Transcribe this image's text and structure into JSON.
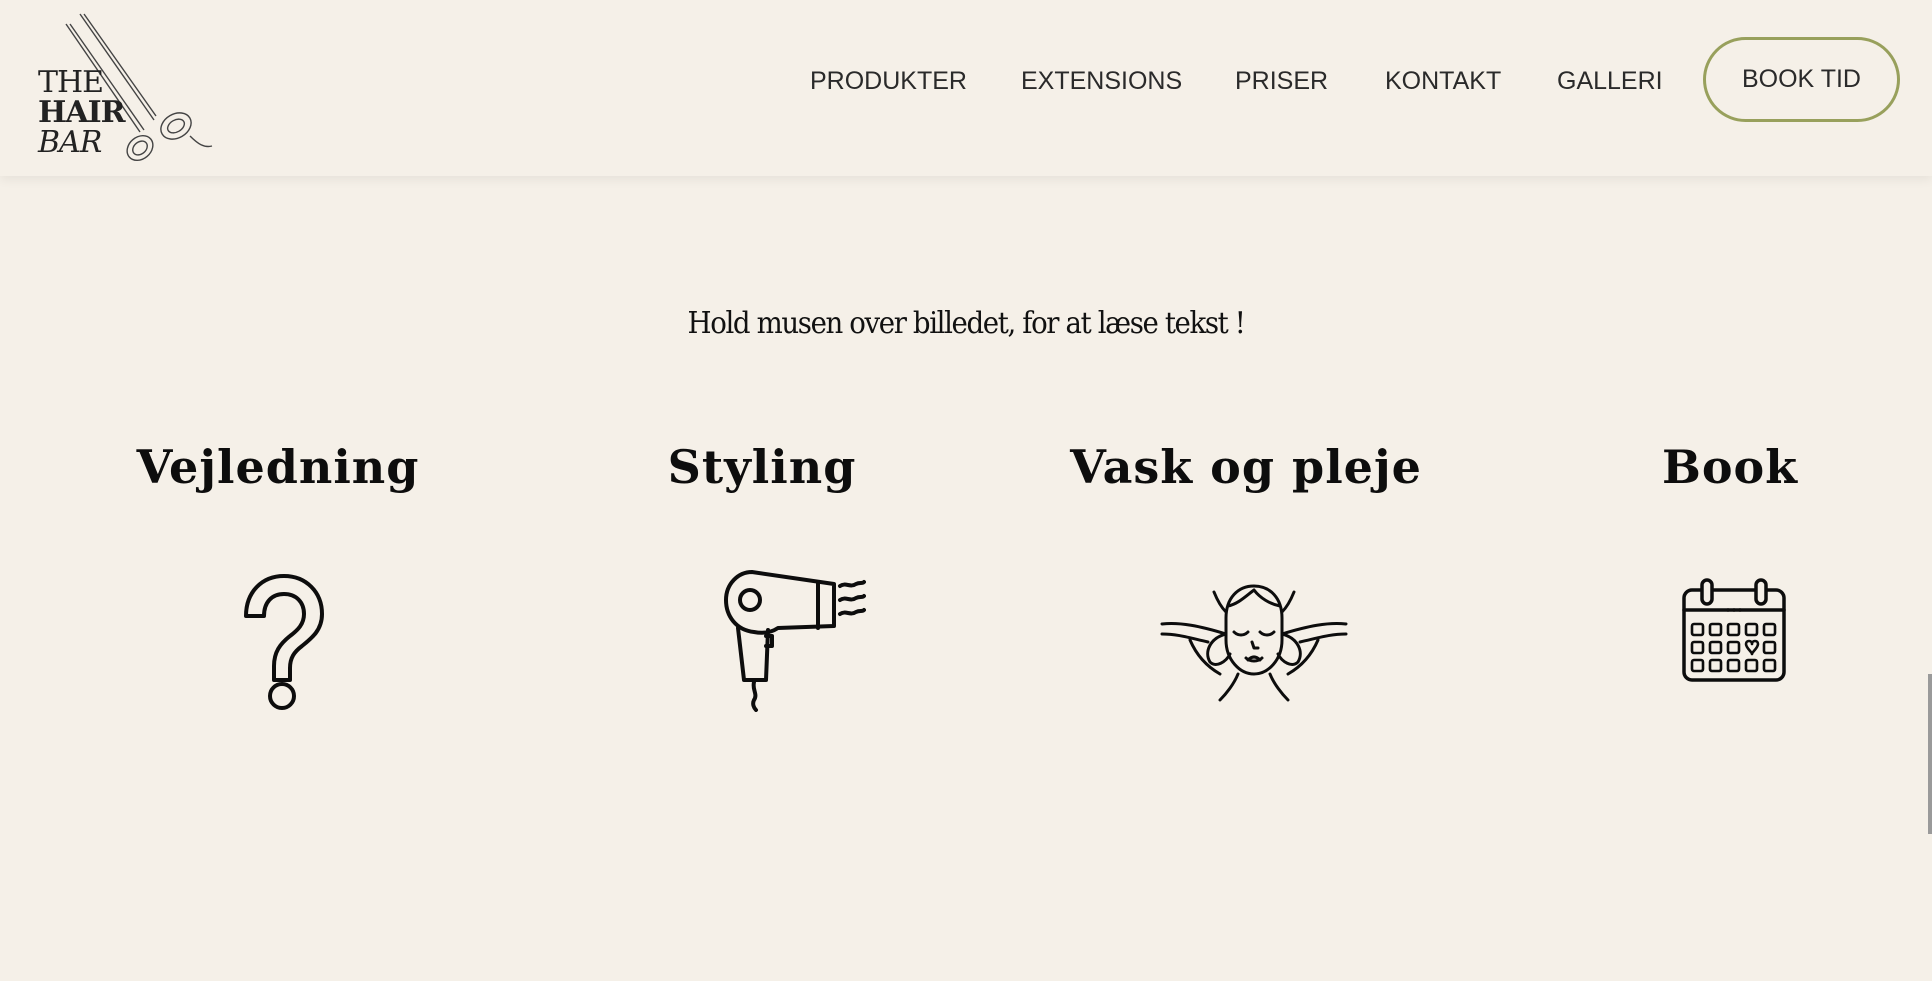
{
  "brand": {
    "logo_line1": "THE",
    "logo_line2": "HAIR",
    "logo_line3": "BAR",
    "logo_icon": "scissors-icon"
  },
  "nav": {
    "items": [
      {
        "label": "PRODUKTER"
      },
      {
        "label": "EXTENSIONS"
      },
      {
        "label": "PRISER"
      },
      {
        "label": "KONTAKT"
      },
      {
        "label": "GALLERI"
      }
    ],
    "cta": "BOOK TID"
  },
  "hint": "Hold musen over billedet, for at læse tekst !",
  "features": [
    {
      "title": "Vejledning",
      "icon": "question-mark-icon"
    },
    {
      "title": "Styling",
      "icon": "hair-dryer-icon"
    },
    {
      "title": "Vask og pleje",
      "icon": "face-massage-icon"
    },
    {
      "title": "Book",
      "icon": "calendar-icon"
    }
  ],
  "colors": {
    "background": "#f5f0e8",
    "accent_border": "#98a05c",
    "text": "#1a1a1a"
  }
}
